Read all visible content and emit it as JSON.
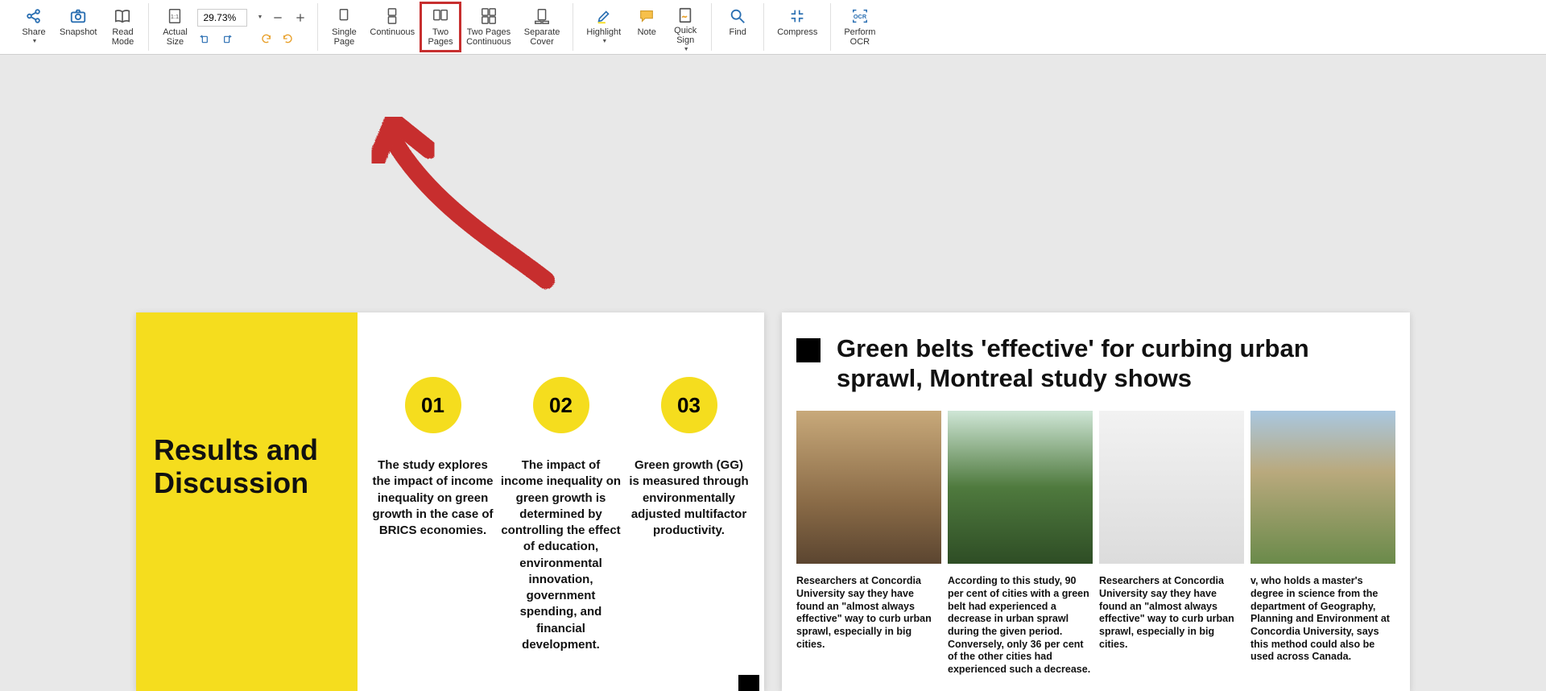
{
  "toolbar": {
    "share_label": "Share",
    "snapshot_label": "Snapshot",
    "read_mode_label": "Read\nMode",
    "actual_size_label": "Actual\nSize",
    "zoom_value": "29.73%",
    "single_page_label": "Single\nPage",
    "continuous_label": "Continuous",
    "two_pages_label": "Two\nPages",
    "two_pages_cont_label": "Two Pages\nContinuous",
    "separate_cover_label": "Separate\nCover",
    "highlight_label": "Highlight",
    "note_label": "Note",
    "quick_sign_label": "Quick\nSign",
    "find_label": "Find",
    "compress_label": "Compress",
    "perform_ocr_label": "Perform\nOCR"
  },
  "left_page": {
    "heading": "Results and Discussion",
    "items": [
      {
        "num": "01",
        "text": "The study explores the impact of income inequality on green growth in the case of BRICS economies."
      },
      {
        "num": "02",
        "text": "The impact of income inequality on green growth is determined by controlling the effect of education, environmental innovation, government spending, and financial development."
      },
      {
        "num": "03",
        "text": "Green growth (GG) is measured through environmentally adjusted multifactor productivity."
      }
    ]
  },
  "right_page": {
    "heading": "Green belts 'effective' for curbing urban sprawl, Montreal study shows",
    "articles": [
      {
        "text": "Researchers at Concordia University say they have found an \"almost always effective\" way to curb urban sprawl, especially in big cities."
      },
      {
        "text": "According to this study, 90 per cent of cities with a green belt had experienced a decrease in urban sprawl during the given period. Conversely, only 36 per cent of the other cities had experienced such a decrease."
      },
      {
        "text": "Researchers at Concordia University say they have found an \"almost always effective\" way to curb urban sprawl, especially in big cities."
      },
      {
        "text": "v, who holds a master's degree in science from the department of Geography, Planning and Environment at Concordia University, says this method could also be used across Canada."
      }
    ]
  }
}
